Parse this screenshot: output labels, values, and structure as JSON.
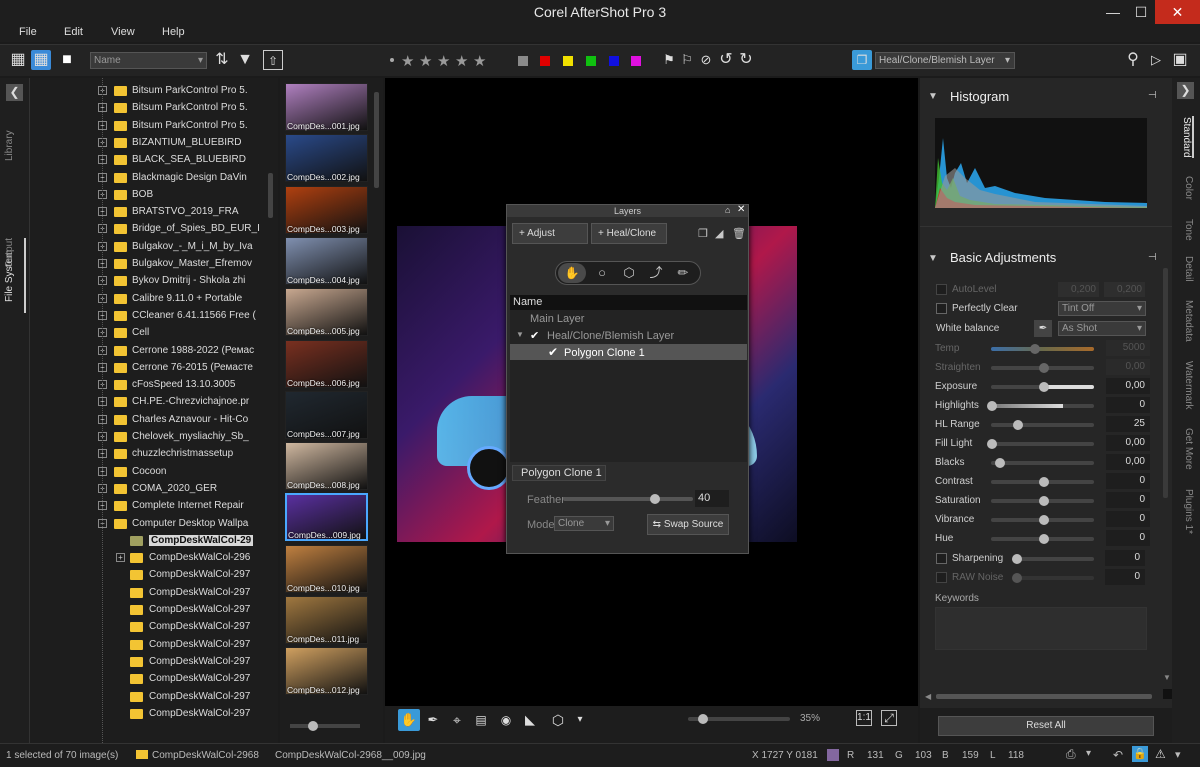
{
  "app": {
    "title": "Corel AfterShot Pro 3"
  },
  "menu": {
    "file": "File",
    "edit": "Edit",
    "view": "View",
    "help": "Help"
  },
  "toolbar": {
    "sort_value": "Name",
    "layer_select": "Heal/Clone/Blemish Layer",
    "swatch_colors": [
      "#8a8a8a",
      "#e00000",
      "#f0e000",
      "#10c010",
      "#1010e0",
      "#e010e0"
    ]
  },
  "left_tabs": {
    "library": "Library",
    "file_system": "File System",
    "output": "Output"
  },
  "tree": {
    "items": [
      {
        "label": "Bitsum ParkControl Pro 5.",
        "level": 0
      },
      {
        "label": "Bitsum ParkControl Pro 5.",
        "level": 0
      },
      {
        "label": "Bitsum ParkControl Pro 5.",
        "level": 0
      },
      {
        "label": "BIZANTIUM_BLUEBIRD",
        "level": 0
      },
      {
        "label": "BLACK_SEA_BLUEBIRD",
        "level": 0
      },
      {
        "label": "Blackmagic Design DaVin",
        "level": 0
      },
      {
        "label": "BOB",
        "level": 0
      },
      {
        "label": "BRATSTVO_2019_FRA",
        "level": 0
      },
      {
        "label": "Bridge_of_Spies_BD_EUR_I",
        "level": 0
      },
      {
        "label": "Bulgakov_-_M_i_M_by_Iva",
        "level": 0
      },
      {
        "label": "Bulgakov_Master_Efremov",
        "level": 0
      },
      {
        "label": "Bykov Dmitrij - Shkola zhi",
        "level": 0
      },
      {
        "label": "Calibre 9.11.0 + Portable",
        "level": 0
      },
      {
        "label": "CCleaner 6.41.11566 Free (",
        "level": 0
      },
      {
        "label": "Cell",
        "level": 0
      },
      {
        "label": "Cerrone 1988-2022 (Ремас",
        "level": 0
      },
      {
        "label": "Cerrone 76-2015 (Ремасте",
        "level": 0
      },
      {
        "label": "cFosSpeed 13.10.3005",
        "level": 0
      },
      {
        "label": "CH.PE.-Chrezvichajnoe.pr",
        "level": 0
      },
      {
        "label": "Charles Aznavour - Hit-Co",
        "level": 0
      },
      {
        "label": "Chelovek_mysliachiy_Sb_",
        "level": 0
      },
      {
        "label": "chuzzlechristmassetup",
        "level": 0
      },
      {
        "label": "Cocoon",
        "level": 0
      },
      {
        "label": "COMA_2020_GER",
        "level": 0
      },
      {
        "label": "Complete Internet Repair ",
        "level": 0
      },
      {
        "label": "Computer Desktop Wallpa",
        "level": 0
      },
      {
        "label": "CompDeskWalCol-29",
        "level": 1,
        "selected": true
      },
      {
        "label": "CompDeskWalCol-296",
        "level": 1
      },
      {
        "label": "CompDeskWalCol-297",
        "level": 1
      },
      {
        "label": "CompDeskWalCol-297",
        "level": 1
      },
      {
        "label": "CompDeskWalCol-297",
        "level": 1
      },
      {
        "label": "CompDeskWalCol-297",
        "level": 1
      },
      {
        "label": "CompDeskWalCol-297",
        "level": 1
      },
      {
        "label": "CompDeskWalCol-297",
        "level": 1
      },
      {
        "label": "CompDeskWalCol-297",
        "level": 1
      },
      {
        "label": "CompDeskWalCol-297",
        "level": 1
      },
      {
        "label": "CompDeskWalCol-297",
        "level": 1
      }
    ]
  },
  "thumbnails": [
    {
      "caption": "CompDes...001.jpg",
      "color": "#b080c0"
    },
    {
      "caption": "CompDes...002.jpg",
      "color": "#2a4a8a"
    },
    {
      "caption": "CompDes...003.jpg",
      "color": "#b04010"
    },
    {
      "caption": "CompDes...004.jpg",
      "color": "#8090b0"
    },
    {
      "caption": "CompDes...005.jpg",
      "color": "#c8a890"
    },
    {
      "caption": "CompDes...006.jpg",
      "color": "#7a3020"
    },
    {
      "caption": "CompDes...007.jpg",
      "color": "#202830"
    },
    {
      "caption": "CompDes...008.jpg",
      "color": "#d0b8a0"
    },
    {
      "caption": "CompDes...009.jpg",
      "color": "#5a30a0"
    },
    {
      "caption": "CompDes...010.jpg",
      "color": "#c08040"
    },
    {
      "caption": "CompDes...011.jpg",
      "color": "#a07840"
    },
    {
      "caption": "CompDes...012.jpg",
      "color": "#d0a060"
    }
  ],
  "layers_dialog": {
    "title": "Layers",
    "adjust_label": "Adjust",
    "heal_label": "Heal/Clone",
    "column_name": "Name",
    "rows": [
      "Main Layer",
      "Heal/Clone/Blemish Layer",
      "Polygon Clone 1"
    ],
    "section_title": "Polygon Clone 1",
    "feather_label": "Feather",
    "feather_value": "40",
    "mode_label": "Mode",
    "mode_value": "Clone",
    "swap_label": "Swap Source"
  },
  "viewer": {
    "zoom": "35%",
    "zoom_fraction": 0.1
  },
  "histogram": {
    "title": "Histogram"
  },
  "basic": {
    "title": "Basic Adjustments",
    "autolevel": {
      "label": "AutoLevel",
      "v1": "0,200",
      "v2": "0,200"
    },
    "perfectly_clear": {
      "label": "Perfectly Clear",
      "value": "Tint Off"
    },
    "white_balance": {
      "label": "White balance",
      "value": "As Shot"
    },
    "sliders": [
      {
        "label": "Temp",
        "value": "5000",
        "pos": 0.42,
        "dim": true
      },
      {
        "label": "Straighten",
        "value": "0,00",
        "pos": 0.5,
        "dim": true
      },
      {
        "label": "Exposure",
        "value": "0,00",
        "pos": 0.5
      },
      {
        "label": "Highlights",
        "value": "0",
        "pos": 0.0
      },
      {
        "label": "HL Range",
        "value": "25",
        "pos": 0.25
      },
      {
        "label": "Fill Light",
        "value": "0,00",
        "pos": 0.0
      },
      {
        "label": "Blacks",
        "value": "0,00",
        "pos": 0.08
      },
      {
        "label": "Contrast",
        "value": "0",
        "pos": 0.5
      },
      {
        "label": "Saturation",
        "value": "0",
        "pos": 0.5
      },
      {
        "label": "Vibrance",
        "value": "0",
        "pos": 0.5
      },
      {
        "label": "Hue",
        "value": "0",
        "pos": 0.5
      }
    ],
    "sharpening": {
      "label": "Sharpening",
      "value": "0",
      "pos": 0.0
    },
    "raw_noise": {
      "label": "RAW Noise",
      "value": "0",
      "pos": 0.0
    },
    "keywords_label": "Keywords",
    "reset_label": "Reset All"
  },
  "right_tabs": [
    "Standard",
    "Color",
    "Tone",
    "Detail",
    "Metadata",
    "Watermark",
    "Get More",
    "Plugins 1*"
  ],
  "status": {
    "selection": "1 selected of 70 image(s)",
    "folder": "CompDeskWalCol-2968",
    "file": "CompDeskWalCol-2968__009.jpg",
    "coords": "X 1727  Y 0181",
    "r_label": "R",
    "r_value": "131",
    "g_label": "G",
    "g_value": "103",
    "b_label": "B",
    "b_value": "159",
    "l_label": "L",
    "l_value": "118",
    "pixel_color": "#83679f"
  }
}
